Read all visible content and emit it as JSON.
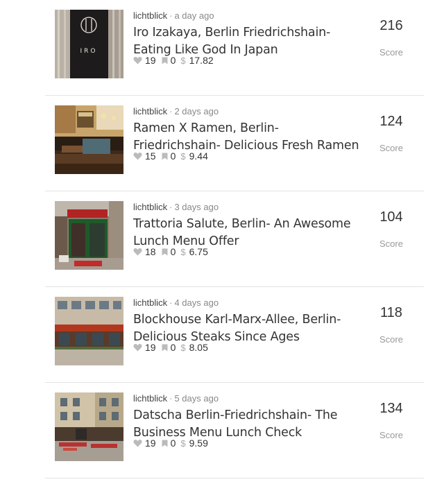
{
  "posts": [
    {
      "author": "lichtblick",
      "time": "a day ago",
      "title": "Iro Izakaya, Berlin Friedrichshain- Eating Like God In Japan",
      "likes": "19",
      "flags": "0",
      "payout": "17.82",
      "score": "216",
      "score_label": "Score",
      "thumbnail": "iro-izakaya-sign"
    },
    {
      "author": "lichtblick",
      "time": "2 days ago",
      "title": "Ramen X Ramen, Berlin- Friedrichshain- Delicious Fresh Ramen",
      "likes": "15",
      "flags": "0",
      "payout": "9.44",
      "score": "124",
      "score_label": "Score",
      "thumbnail": "ramen-interior"
    },
    {
      "author": "lichtblick",
      "time": "3 days ago",
      "title": "Trattoria Salute, Berlin- An Awesome Lunch Menu Offer",
      "likes": "18",
      "flags": "0",
      "payout": "6.75",
      "score": "104",
      "score_label": "Score",
      "thumbnail": "trattoria-storefront"
    },
    {
      "author": "lichtblick",
      "time": "4 days ago",
      "title": "Blockhouse Karl-Marx-Allee, Berlin- Delicious Steaks Since Ages",
      "likes": "19",
      "flags": "0",
      "payout": "8.05",
      "score": "118",
      "score_label": "Score",
      "thumbnail": "blockhouse-facade"
    },
    {
      "author": "lichtblick",
      "time": "5 days ago",
      "title": "Datscha Berlin-Friedrichshain- The Business Menu Lunch Check",
      "likes": "19",
      "flags": "0",
      "payout": "9.59",
      "score": "134",
      "score_label": "Score",
      "thumbnail": "datscha-terrace"
    }
  ],
  "icons": {
    "like": "heart-icon",
    "flag": "flag-icon",
    "payout": "dollar-icon"
  },
  "colors": {
    "text": "#333333",
    "muted": "#999999",
    "icon": "#bbbbbb",
    "divider": "#e3e3e3"
  }
}
